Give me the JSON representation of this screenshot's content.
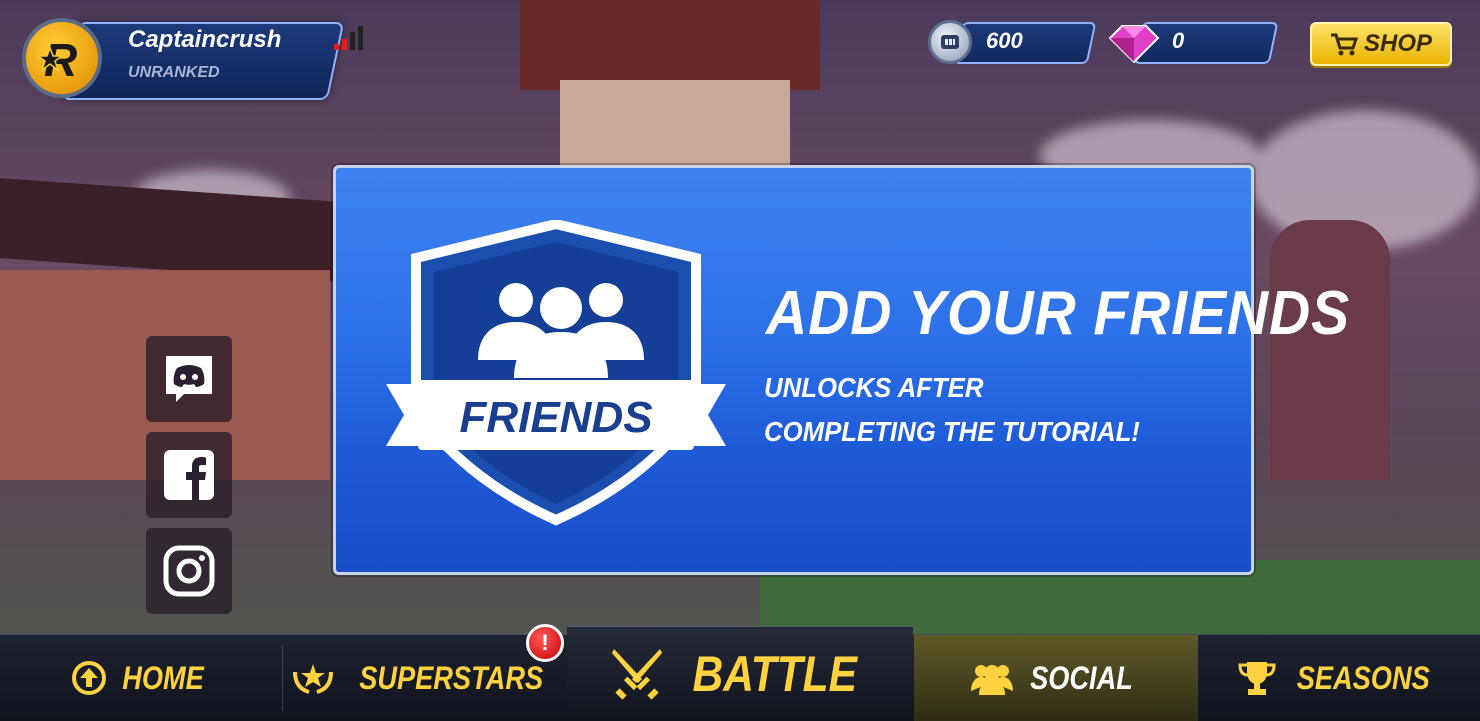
{
  "player": {
    "name": "Captaincrush",
    "rank": "UNRANKED",
    "avatar_icon": "r-star-logo-icon",
    "signal_icon": "signal-bars-icon"
  },
  "currency": {
    "coins": {
      "value": "600",
      "icon": "coin-icon"
    },
    "gems": {
      "value": "0",
      "icon": "gem-icon"
    }
  },
  "shop": {
    "label": "SHOP",
    "icon": "cart-icon"
  },
  "social_links": [
    {
      "name": "discord",
      "icon": "discord-icon"
    },
    {
      "name": "facebook",
      "icon": "facebook-icon"
    },
    {
      "name": "instagram",
      "icon": "instagram-icon"
    }
  ],
  "panel": {
    "badge_label": "FRIENDS",
    "title": "ADD YOUR FRIENDS",
    "subtitle": "UNLOCKS AFTER COMPLETING THE TUTORIAL!"
  },
  "nav": {
    "home": "HOME",
    "superstars": "SUPERSTARS",
    "superstars_alert": "!",
    "battle": "BATTLE",
    "social": "SOCIAL",
    "seasons": "SEASONS",
    "active": "social"
  },
  "colors": {
    "accent_yellow": "#ffd23f",
    "panel_blue": "#2a6ee8",
    "nav_dark": "#151922"
  }
}
